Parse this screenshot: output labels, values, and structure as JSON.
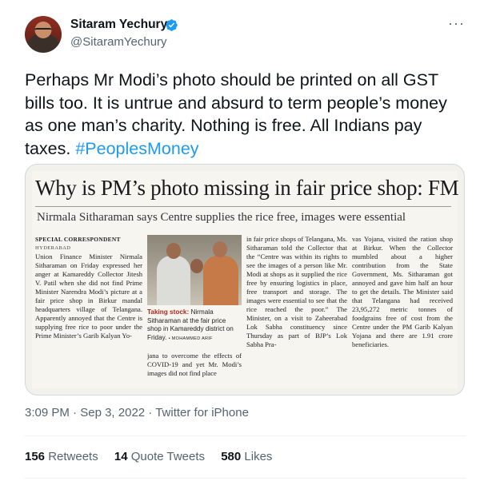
{
  "author": {
    "name": "Sitaram Yechury",
    "handle": "@SitaramYechury",
    "verified": true,
    "more_icon": "more-horizontal-icon"
  },
  "tweet": {
    "text": "Perhaps Mr Modi’s photo should be printed on all GST bills too. It is untrue and absurd to term people’s money as one man’s charity. Nothing is free. All Indians pay taxes. ",
    "hashtag": "#PeoplesMoney"
  },
  "clipping": {
    "headline": "Why is PM’s photo missing in fair price shop: FM",
    "subheadline": "Nirmala Sitharaman says Centre supplies the rice free, images were essential",
    "byline": "SPECIAL CORRESPONDENT",
    "dateline": "HYDERABAD",
    "col1": "Union Finance Minister Nirmala Sitharaman on Friday expressed her anger at Kamareddy Collector Jitesh V. Patil when she did not find Prime Minister Narendra Modi’s picture at a fair price shop in Birkur mandal headquarters village of Telangana. Apparently annoyed that the Centre is supplying free rice to poor under the Prime Minister’s Garib Kalyan Yo-",
    "col2": "jana to overcome the effects of COVID-19 and yet Mr. Modi’s images did not find place",
    "col3": "in fair price shops of Telangana, Ms. Sitharaman told the Collector that the “Centre was within its rights to see the images of a person like Mr. Modi at shops as it supplied the rice free by ensuring logistics in place, free transport and storage. The images were essential to see that the rice reached the poor.” The Minister, on a visit to Zaheerabad Lok Sabha constituency since Thursday as part of BJP’s Lok Sabha Pra-",
    "col4": "vas Yojana, visited the ration shop at Birkur. When the Collector mumbled about a higher contribution from the State Government, Ms. Sitharaman got annoyed and gave him half an hour to get the details. The Minister said that Telangana had received 23,95,272 metric tonnes of foodgrains free of cost from the Centre under the PM Garib Kalyan Yojana and there are 1.91 crore beneficiaries.",
    "caption_label": "Taking stock:",
    "caption_text": " Nirmala Sitharaman at the fair price shop in Kamareddy district on Friday.",
    "photo_credit": "• MOHAMMED ARIF"
  },
  "meta": {
    "time": "3:09 PM",
    "date": "Sep 3, 2022",
    "source": "Twitter for iPhone",
    "separator": " · "
  },
  "stats": {
    "retweets": "156",
    "retweets_label": " Retweets",
    "quotes": "14",
    "quotes_label": " Quote Tweets",
    "likes": "580",
    "likes_label": " Likes"
  },
  "colors": {
    "link": "#1d9bf0",
    "secondary_text": "#536471",
    "primary_text": "#0f1419",
    "caption_accent": "#b3261e"
  }
}
